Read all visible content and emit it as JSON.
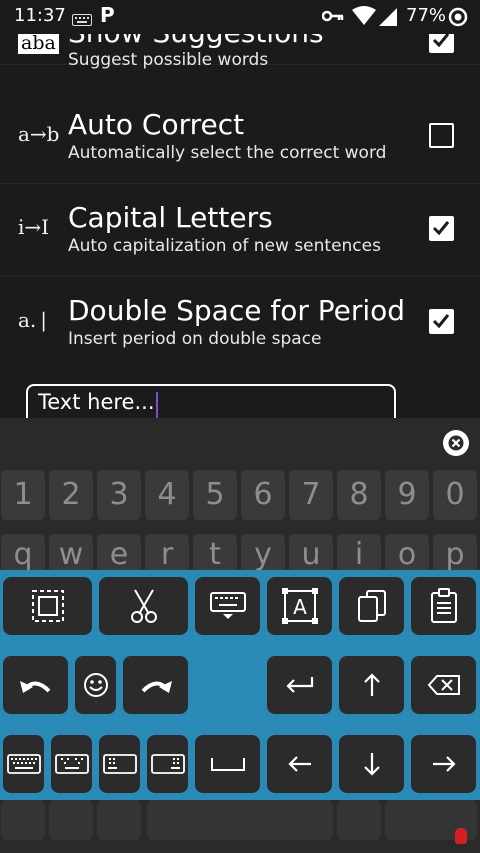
{
  "status_bar": {
    "time": "11:37",
    "app_letter": "P",
    "battery": "77%"
  },
  "settings": [
    {
      "icon": "aba",
      "title": "Show Suggestions",
      "subtitle": "Suggest possible words",
      "checked": true
    },
    {
      "icon": "a→b",
      "title": "Auto Correct",
      "subtitle": "Automatically select the correct word",
      "checked": false
    },
    {
      "icon": "i→I",
      "title": "Capital Letters",
      "subtitle": "Auto capitalization of new sentences",
      "checked": true
    },
    {
      "icon": "a. |",
      "title": "Double Space for Period",
      "subtitle": "Insert period on double space",
      "checked": true
    }
  ],
  "text_field": {
    "value": "Text here..."
  },
  "keyboard": {
    "number_row": [
      "1",
      "2",
      "3",
      "4",
      "5",
      "6",
      "7",
      "8",
      "9",
      "0"
    ],
    "letter_row": [
      "q",
      "w",
      "e",
      "r",
      "t",
      "y",
      "u",
      "i",
      "o",
      "p"
    ]
  },
  "edit_panel": {
    "row1": [
      "select-all",
      "cut",
      "hide-keyboard",
      "select-text",
      "copy",
      "paste"
    ],
    "row2": [
      "undo",
      "emoji",
      "redo",
      "enter",
      "shift-up",
      "backspace"
    ],
    "row3": [
      "keyboard-size-1",
      "keyboard-size-2",
      "keyboard-size-3",
      "keyboard-size-4",
      "space",
      "arrow-left",
      "arrow-down",
      "arrow-right"
    ]
  },
  "colors": {
    "background": "#1b1b1b",
    "edit_panel": "#2a8ab5",
    "edit_key": "#2b2b2b",
    "caret": "#7a4fd6"
  }
}
